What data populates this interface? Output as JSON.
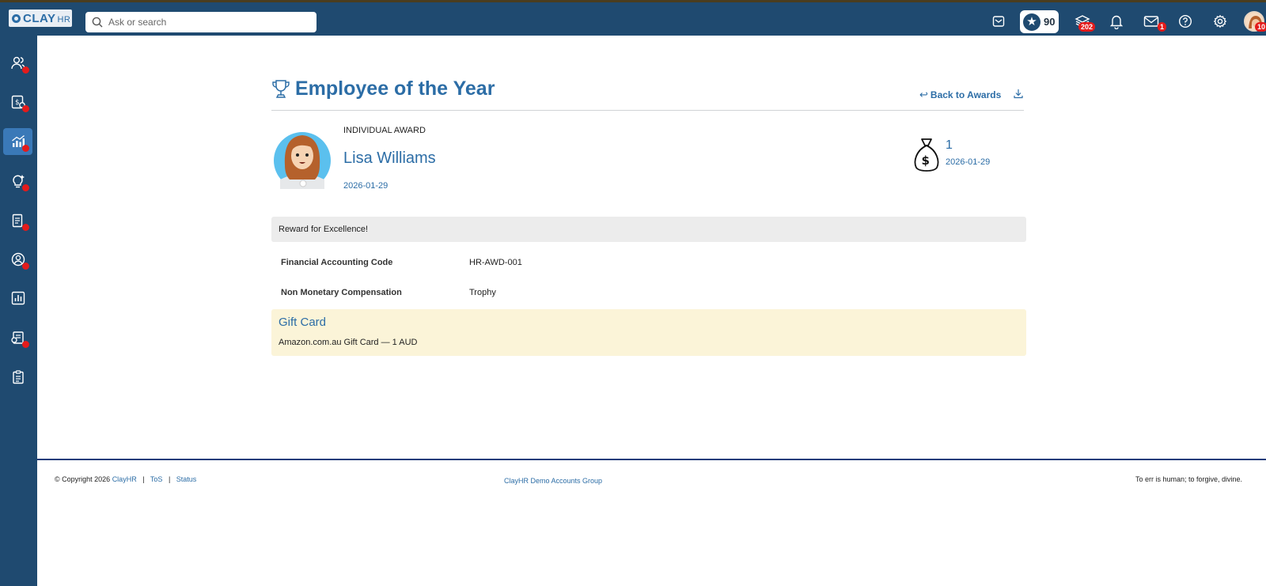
{
  "topbar": {
    "logo_text": "CLAY",
    "logo_suffix": "HR",
    "search_placeholder": "Ask or search",
    "points": "90",
    "stack_badge": "202",
    "mail_badge": "1",
    "avatar_badge": "10"
  },
  "sidebar": {
    "items": [
      {
        "icon": "people-icon",
        "has_dot": true
      },
      {
        "icon": "payroll-icon",
        "has_dot": true
      },
      {
        "icon": "performance-chart-icon",
        "has_dot": true,
        "active": true
      },
      {
        "icon": "lightbulb-icon",
        "has_dot": true
      },
      {
        "icon": "documents-icon",
        "has_dot": true
      },
      {
        "icon": "profile-icon",
        "has_dot": true
      },
      {
        "icon": "reports-icon",
        "has_dot": false
      },
      {
        "icon": "recruiting-icon",
        "has_dot": true
      },
      {
        "icon": "clipboard-icon",
        "has_dot": false
      }
    ]
  },
  "award": {
    "title": "Employee of the Year",
    "back_label": "Back to Awards",
    "type": "INDIVIDUAL AWARD",
    "employee_name": "Lisa Williams",
    "date": "2026-01-29",
    "amount": "1",
    "amount_date": "2026-01-29",
    "reason": "Reward for Excellence!",
    "details": [
      {
        "label": "Financial Accounting Code",
        "value": "HR-AWD-001"
      },
      {
        "label": "Non Monetary Compensation",
        "value": "Trophy"
      }
    ],
    "gift_card": {
      "title": "Gift Card",
      "description": "Amazon.com.au Gift Card — 1 AUD"
    }
  },
  "footer": {
    "copyright": "© Copyright 2026",
    "brand_link": "ClayHR",
    "tos": "ToS",
    "status": "Status",
    "org": "ClayHR Demo Accounts Group",
    "quote": "To err is human; to forgive, divine."
  },
  "colors": {
    "nav_bg": "#1f4a70",
    "accent": "#2c6da6",
    "badge": "#e41b1b",
    "gift_bg": "#fbf4d8"
  }
}
